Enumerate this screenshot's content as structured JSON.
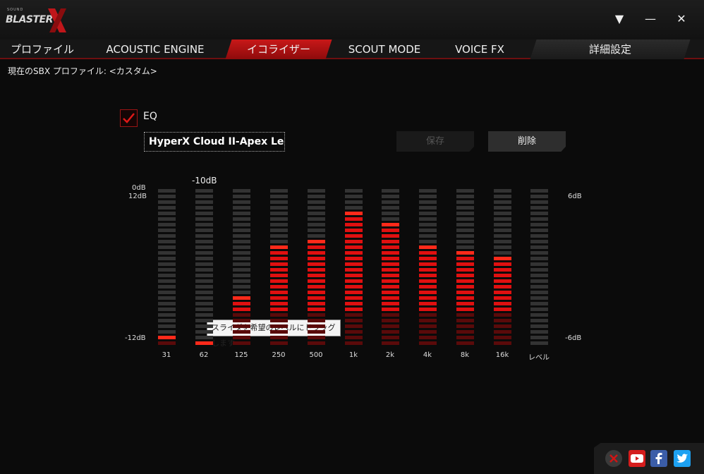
{
  "app": {
    "logo_small": "SOUND",
    "logo_text": "BLASTER",
    "brand_color": "#c0161a"
  },
  "window_controls": {
    "dropdown": "▼",
    "minimize": "—",
    "close": "✕"
  },
  "tabs": [
    {
      "label": "プロファイル",
      "active": false
    },
    {
      "label": "ACOUSTIC ENGINE",
      "active": false
    },
    {
      "label": "イコライザー",
      "active": true
    },
    {
      "label": "SCOUT MODE",
      "active": false
    },
    {
      "label": "VOICE FX",
      "active": false
    },
    {
      "label": "詳細設定",
      "active": false
    }
  ],
  "profile": {
    "line": "現在のSBX プロファイル: <カスタム>"
  },
  "eq": {
    "enabled": true,
    "label": "EQ",
    "preset_value": "HyperX Cloud II-Apex Legends",
    "save_label": "保存",
    "delete_label": "削除",
    "left_scale": {
      "top_a": "0dB",
      "top_b": "12dB",
      "bottom": "-12dB"
    },
    "right_scale": {
      "top": "6dB",
      "bottom": "-6dB"
    },
    "drag_value": "-10dB",
    "tooltip": "スライダを希望のレベルにドラッグします",
    "bands": [
      {
        "label": "31",
        "level_db": -10
      },
      {
        "label": "62",
        "level_db": -12
      },
      {
        "label": "125",
        "level_db": -4.5
      },
      {
        "label": "250",
        "level_db": 3.5
      },
      {
        "label": "500",
        "level_db": 4.5
      },
      {
        "label": "1k",
        "level_db": 8.5
      },
      {
        "label": "2k",
        "level_db": 7
      },
      {
        "label": "4k",
        "level_db": 3.5
      },
      {
        "label": "8k",
        "level_db": 2.5
      },
      {
        "label": "16k",
        "level_db": 1.5
      }
    ],
    "level_label": "レベル",
    "level_meter": 0,
    "colors": {
      "active": "#e01010",
      "dim": "#5a0a0a",
      "empty": "#333333"
    }
  },
  "footer": {
    "icons": [
      "close-circle-icon",
      "youtube-icon",
      "facebook-icon",
      "twitter-icon"
    ]
  }
}
